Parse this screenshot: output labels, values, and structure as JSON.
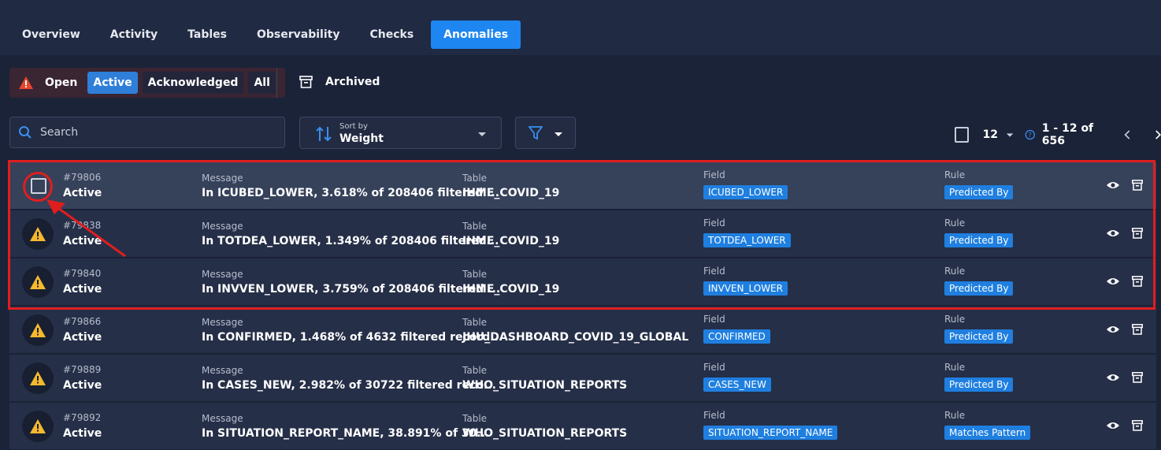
{
  "tabs": [
    {
      "label": "Overview",
      "active": false
    },
    {
      "label": "Activity",
      "active": false
    },
    {
      "label": "Tables",
      "active": false
    },
    {
      "label": "Observability",
      "active": false
    },
    {
      "label": "Checks",
      "active": false
    },
    {
      "label": "Anomalies",
      "active": true
    }
  ],
  "status": {
    "open_label": "Open",
    "active_label": "Active",
    "acknowledged_label": "Acknowledged",
    "all_label": "All",
    "archived_label": "Archived"
  },
  "search": {
    "placeholder": "Search"
  },
  "sort": {
    "label": "Sort by",
    "value": "Weight"
  },
  "pager": {
    "per_page": "12",
    "range": "1 - 12 of 656"
  },
  "labels": {
    "message": "Message",
    "table": "Table",
    "field": "Field",
    "rule": "Rule"
  },
  "rows": [
    {
      "id": "#79806",
      "status": "Active",
      "message": "In ICUBED_LOWER, 3.618% of 208406 filtered ...",
      "table": "IHME_COVID_19",
      "field": "ICUBED_LOWER",
      "rule": "Predicted By"
    },
    {
      "id": "#79838",
      "status": "Active",
      "message": "In TOTDEA_LOWER, 1.349% of 208406 filtered...",
      "table": "IHME_COVID_19",
      "field": "TOTDEA_LOWER",
      "rule": "Predicted By"
    },
    {
      "id": "#79840",
      "status": "Active",
      "message": "In INVVEN_LOWER, 3.759% of 208406 filtered ...",
      "table": "IHME_COVID_19",
      "field": "INVVEN_LOWER",
      "rule": "Predicted By"
    },
    {
      "id": "#79866",
      "status": "Active",
      "message": "In CONFIRMED, 1.468% of 4632 filtered record...",
      "table": "JHU_DASHBOARD_COVID_19_GLOBAL",
      "field": "CONFIRMED",
      "rule": "Predicted By"
    },
    {
      "id": "#79889",
      "status": "Active",
      "message": "In CASES_NEW, 2.982% of 30722 filtered reco...",
      "table": "WHO_SITUATION_REPORTS",
      "field": "CASES_NEW",
      "rule": "Predicted By"
    },
    {
      "id": "#79892",
      "status": "Active",
      "message": "In SITUATION_REPORT_NAME, 38.891% of 30...",
      "table": "WHO_SITUATION_REPORTS",
      "field": "SITUATION_REPORT_NAME",
      "rule": "Matches Pattern"
    }
  ],
  "colors": {
    "accent": "#1e86f0",
    "highlight": "#e01e1e",
    "warning": "#f5b82e",
    "alert": "#e8472d"
  }
}
